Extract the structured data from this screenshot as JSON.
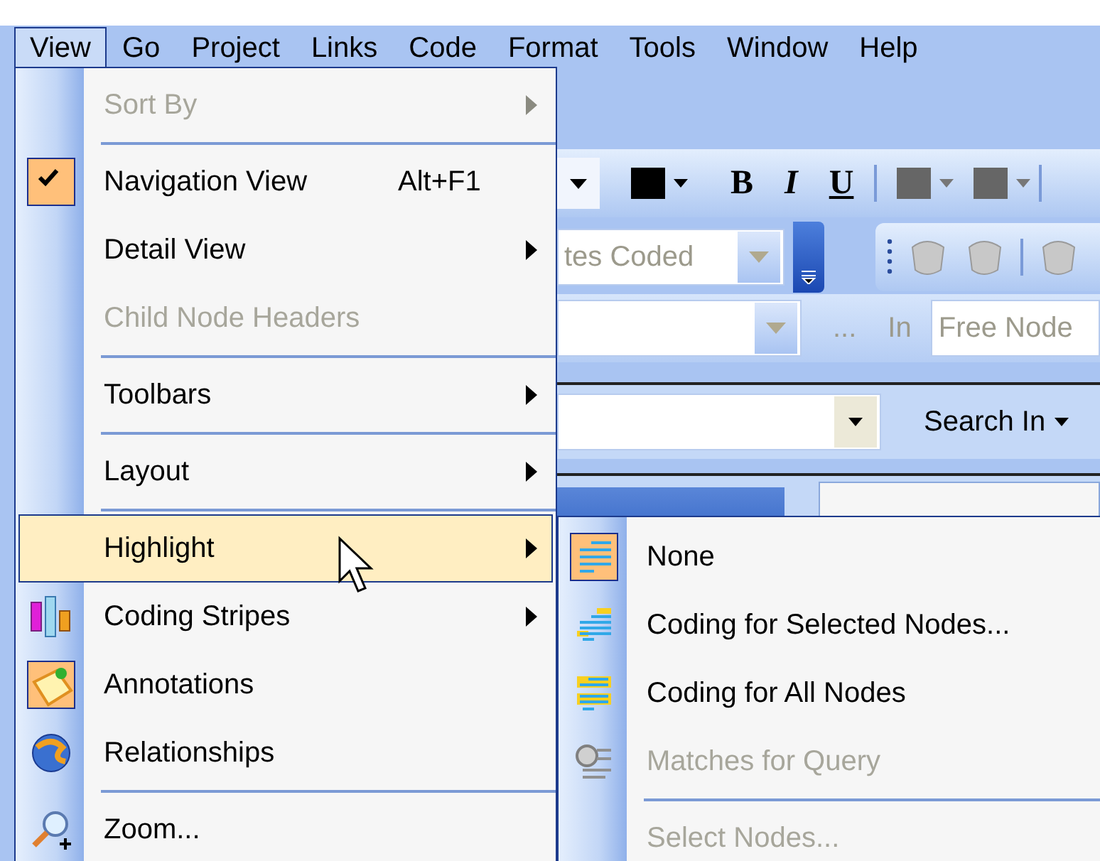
{
  "menu_bar": [
    {
      "label": "View",
      "selected": true
    },
    {
      "label": "Go",
      "selected": false
    },
    {
      "label": "Project",
      "selected": false
    },
    {
      "label": "Links",
      "selected": false
    },
    {
      "label": "Code",
      "selected": false
    },
    {
      "label": "Format",
      "selected": false
    },
    {
      "label": "Tools",
      "selected": false
    },
    {
      "label": "Window",
      "selected": false
    },
    {
      "label": "Help",
      "selected": false
    }
  ],
  "toolbars": {
    "format": {
      "bold": "B",
      "italic": "I",
      "underline": "U"
    },
    "coding": {
      "combo_value": "tes Coded"
    },
    "find": {
      "ellipsis": "...",
      "in_label": "In",
      "scope_value": "Free Node"
    },
    "search": {
      "search_in": "Search In"
    }
  },
  "menu": {
    "items": [
      {
        "kind": "item",
        "label": "Sort By",
        "disabled": true,
        "checked": false,
        "has_submenu": true,
        "selected": false
      },
      {
        "kind": "separator"
      },
      {
        "kind": "item",
        "label": "Navigation View",
        "shortcut": "Alt+F1",
        "disabled": false,
        "checked": true,
        "has_submenu": false,
        "selected": false
      },
      {
        "kind": "item",
        "label": "Detail View",
        "disabled": false,
        "checked": false,
        "has_submenu": true,
        "selected": false
      },
      {
        "kind": "item",
        "label": "Child Node Headers",
        "disabled": true,
        "checked": false,
        "has_submenu": false,
        "selected": false
      },
      {
        "kind": "separator"
      },
      {
        "kind": "item",
        "label": "Toolbars",
        "disabled": false,
        "checked": false,
        "has_submenu": true,
        "selected": false
      },
      {
        "kind": "separator"
      },
      {
        "kind": "item",
        "label": "Layout",
        "disabled": false,
        "checked": false,
        "has_submenu": true,
        "selected": false
      },
      {
        "kind": "separator"
      },
      {
        "kind": "item",
        "label": "Highlight",
        "disabled": false,
        "checked": false,
        "has_submenu": true,
        "selected": true
      },
      {
        "kind": "item",
        "label": "Coding Stripes",
        "disabled": false,
        "checked": false,
        "has_submenu": true,
        "selected": false
      },
      {
        "kind": "item",
        "label": "Annotations",
        "disabled": false,
        "checked": true,
        "has_submenu": false,
        "selected": false
      },
      {
        "kind": "item",
        "label": "Relationships",
        "disabled": false,
        "checked": false,
        "has_submenu": false,
        "selected": false
      },
      {
        "kind": "separator"
      },
      {
        "kind": "item",
        "label": "Zoom...",
        "disabled": false,
        "checked": false,
        "has_submenu": false,
        "selected": false
      }
    ]
  },
  "submenu": {
    "items": [
      {
        "kind": "item",
        "label": "None",
        "disabled": false,
        "checked": true,
        "selected": false
      },
      {
        "kind": "item",
        "label": "Coding for Selected Nodes...",
        "disabled": false,
        "checked": false,
        "selected": false
      },
      {
        "kind": "item",
        "label": "Coding for All Nodes",
        "disabled": false,
        "checked": false,
        "selected": false
      },
      {
        "kind": "item",
        "label": "Matches for Query",
        "disabled": true,
        "checked": false,
        "selected": false
      },
      {
        "kind": "separator"
      },
      {
        "kind": "item",
        "label": "Select Nodes...",
        "disabled": true,
        "checked": false,
        "selected": false
      }
    ]
  }
}
